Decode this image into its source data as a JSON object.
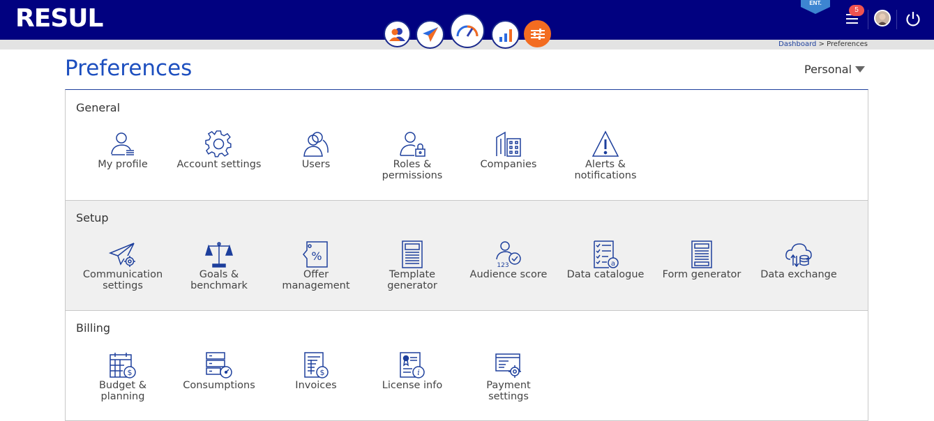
{
  "app": {
    "logo": "RESUL",
    "badge": "ENT.",
    "notifications_count": "5"
  },
  "colors": {
    "topbar": "#010180",
    "accent": "#f36c21",
    "icon": "#1d3f9c",
    "title": "#1d4fbf"
  },
  "nav": {
    "items": [
      {
        "icon": "contacts-icon"
      },
      {
        "icon": "send-icon"
      },
      {
        "icon": "dashboard-gauge-icon"
      },
      {
        "icon": "bar-chart-icon"
      },
      {
        "icon": "sliders-icon",
        "active": true
      }
    ]
  },
  "breadcrumb": {
    "link": "Dashboard",
    "separator": ">",
    "current": "Preferences"
  },
  "page": {
    "title": "Preferences",
    "scope": "Personal"
  },
  "sections": [
    {
      "title": "General",
      "items": [
        {
          "label": "My profile",
          "icon": "user-profile-icon"
        },
        {
          "label": "Account settings",
          "icon": "gear-icon"
        },
        {
          "label": "Users",
          "icon": "users-icon"
        },
        {
          "label": "Roles &\npermissions",
          "icon": "user-lock-icon"
        },
        {
          "label": "Companies",
          "icon": "buildings-icon"
        },
        {
          "label": "Alerts &\nnotifications",
          "icon": "warning-icon"
        }
      ]
    },
    {
      "title": "Setup",
      "items": [
        {
          "label": "Communication\nsettings",
          "icon": "paper-plane-gear-icon"
        },
        {
          "label": "Goals &\nbenchmark",
          "icon": "scale-icon"
        },
        {
          "label": "Offer\nmanagement",
          "icon": "percent-tag-icon"
        },
        {
          "label": "Template\ngenerator",
          "icon": "template-icon"
        },
        {
          "label": "Audience score",
          "icon": "user-score-icon"
        },
        {
          "label": "Data catalogue",
          "icon": "checklist-icon"
        },
        {
          "label": "Form generator",
          "icon": "form-icon"
        },
        {
          "label": "Data exchange",
          "icon": "cloud-exchange-icon"
        }
      ]
    },
    {
      "title": "Billing",
      "items": [
        {
          "label": "Budget &\nplanning",
          "icon": "calendar-dollar-icon"
        },
        {
          "label": "Consumptions",
          "icon": "server-gauge-icon"
        },
        {
          "label": "Invoices",
          "icon": "invoice-icon"
        },
        {
          "label": "License info",
          "icon": "license-icon"
        },
        {
          "label": "Payment\nsettings",
          "icon": "payment-gear-icon"
        }
      ]
    }
  ]
}
